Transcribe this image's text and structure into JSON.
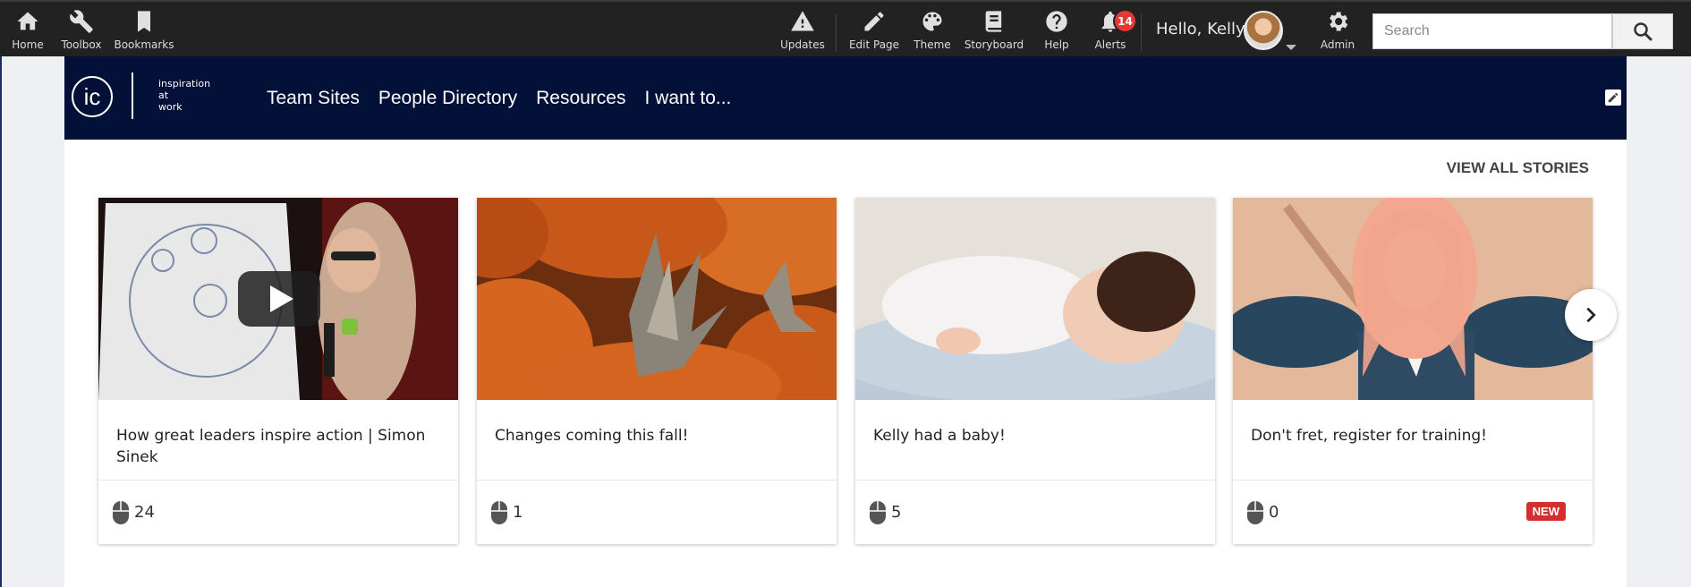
{
  "toolbar": {
    "left_items": [
      {
        "label": "Home",
        "icon": "home-icon"
      },
      {
        "label": "Toolbox",
        "icon": "wrench-icon"
      },
      {
        "label": "Bookmarks",
        "icon": "bookmark-icon"
      }
    ],
    "right_items": [
      {
        "label": "Updates",
        "icon": "warning-icon"
      },
      {
        "label": "Edit Page",
        "icon": "pencil-icon"
      },
      {
        "label": "Theme",
        "icon": "palette-icon"
      },
      {
        "label": "Storyboard",
        "icon": "book-icon"
      },
      {
        "label": "Help",
        "icon": "help-icon"
      },
      {
        "label": "Alerts",
        "icon": "bell-icon",
        "badge": "14"
      }
    ],
    "greeting": "Hello, Kelly",
    "admin_label": "Admin",
    "search_placeholder": "Search"
  },
  "header": {
    "logo_mark": "ic",
    "logo_lines": [
      "inspiration",
      "at",
      "work"
    ],
    "nav": [
      "Team Sites",
      "People Directory",
      "Resources",
      "I want to..."
    ]
  },
  "stories": {
    "view_all": "VIEW ALL STORIES",
    "cards": [
      {
        "title": "How great leaders inspire action | Simon Sinek",
        "count": "24",
        "image": "presenter-video",
        "new": ""
      },
      {
        "title": "Changes coming this fall!",
        "count": "1",
        "image": "pumpkins",
        "new": ""
      },
      {
        "title": "Kelly had a baby!",
        "count": "5",
        "image": "sleeping-baby",
        "new": ""
      },
      {
        "title": "Don't fret, register for training!",
        "count": "0",
        "image": "woman-portrait",
        "new": "NEW"
      }
    ]
  },
  "colors": {
    "toolbar_bg": "#222222",
    "header_bg": "#031037",
    "badge_red": "#e53935",
    "new_badge": "#d32f2f"
  }
}
